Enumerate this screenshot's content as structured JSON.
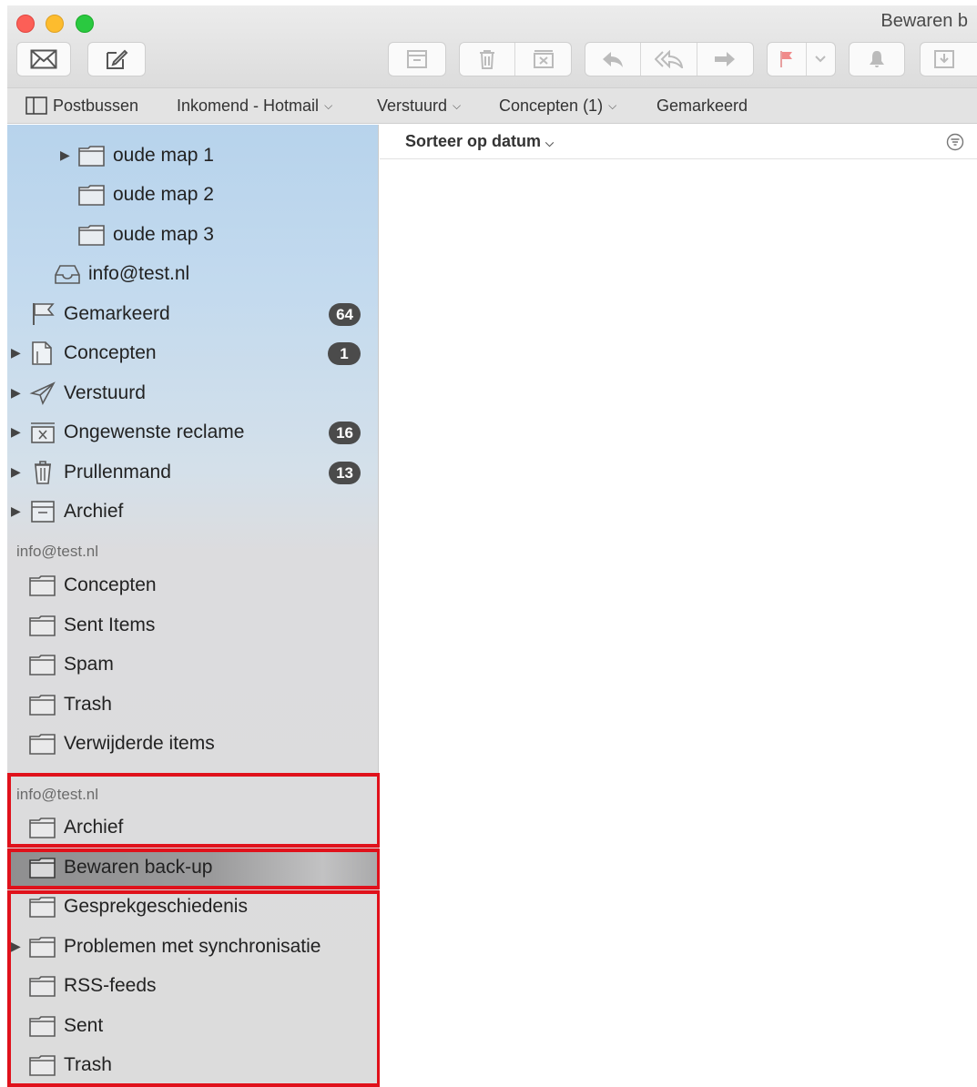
{
  "window": {
    "title": "Bewaren b"
  },
  "toolbar": {
    "icons": [
      "envelope-icon",
      "compose-icon",
      "archive-icon",
      "trash-icon",
      "junk-icon",
      "reply-icon",
      "reply-all-icon",
      "forward-icon",
      "flag-icon",
      "chevron-down-icon",
      "bell-icon",
      "move-icon"
    ]
  },
  "favorites": {
    "mailboxes": "Postbussen",
    "inbox": "Inkomend - Hotmail",
    "sent": "Verstuurd",
    "drafts": "Concepten (1)",
    "flagged": "Gemarkeerd"
  },
  "sidebar": {
    "items": [
      {
        "label": "oude map 1",
        "icon": "folder-icon",
        "has_disclosure": true
      },
      {
        "label": "oude map 2",
        "icon": "folder-icon"
      },
      {
        "label": "oude map 3",
        "icon": "folder-icon"
      },
      {
        "label": "info@test.nl",
        "icon": "inbox-tray-icon"
      },
      {
        "label": "Gemarkeerd",
        "icon": "flag-icon",
        "badge": "64"
      },
      {
        "label": "Concepten",
        "icon": "draft-icon",
        "badge": "1",
        "has_disclosure": true
      },
      {
        "label": "Verstuurd",
        "icon": "paper-plane-icon",
        "has_disclosure": true
      },
      {
        "label": "Ongewenste reclame",
        "icon": "junk-icon",
        "badge": "16",
        "has_disclosure": true
      },
      {
        "label": "Prullenmand",
        "icon": "trash-icon",
        "badge": "13",
        "has_disclosure": true
      },
      {
        "label": "Archief",
        "icon": "archive-icon",
        "has_disclosure": true
      }
    ],
    "section1": {
      "header": "info@test.nl",
      "items": [
        "Concepten",
        "Sent Items",
        "Spam",
        "Trash",
        "Verwijderde items"
      ]
    },
    "section2": {
      "header": "info@test.nl",
      "items": [
        "Archief",
        "Bewaren back-up",
        "Gesprekgeschiedenis",
        "Problemen met synchronisatie",
        "RSS-feeds",
        "Sent",
        "Trash"
      ],
      "selected": "Bewaren back-up"
    }
  },
  "message_list": {
    "sort_label": "Sorteer op datum"
  },
  "colors": {
    "highlight_border": "#e0111b",
    "badge": "#4b4b4b",
    "sidebar_top": "#b7d3ec",
    "sidebar_bottom": "#dcdcdc"
  }
}
